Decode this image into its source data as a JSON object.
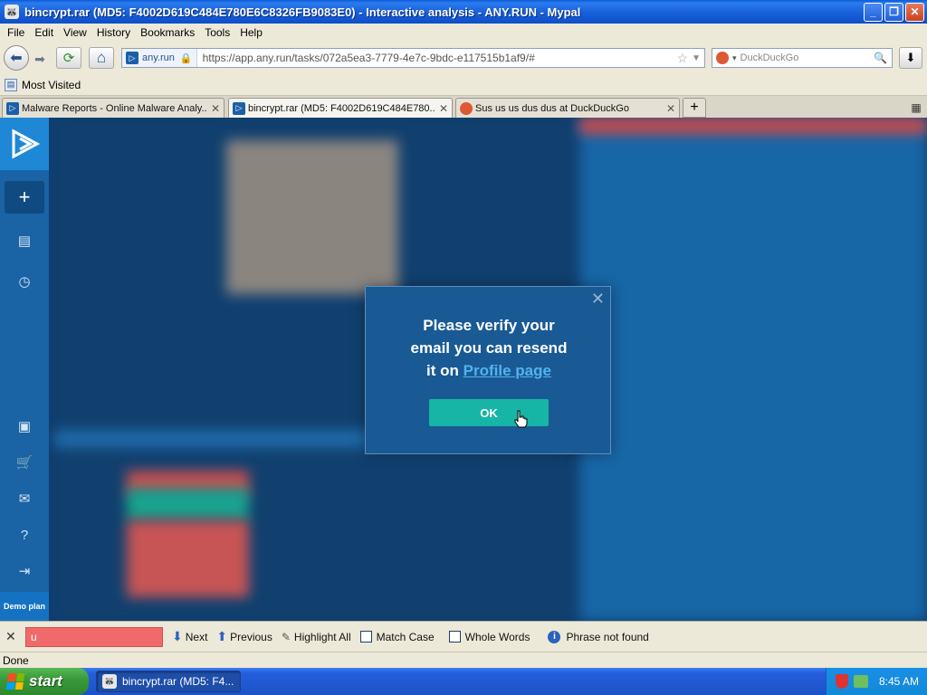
{
  "window": {
    "title": "bincrypt.rar (MD5: F4002D619C484E780E6C8326FB9083E0) - Interactive analysis - ANY.RUN - Mypal",
    "minimize": "_",
    "maximize": "❐",
    "close": "✕"
  },
  "menu": {
    "items": [
      "File",
      "Edit",
      "View",
      "History",
      "Bookmarks",
      "Tools",
      "Help"
    ]
  },
  "nav": {
    "back_glyph": "⬅",
    "forward_glyph": "➡",
    "reload_glyph": "⟳",
    "home_glyph": "⌂",
    "site_identity": "any.run",
    "url": "https://app.any.run/tasks/072a5ea3-7779-4e7c-9bdc-e117515b1af9/#",
    "search_engine": "DuckDuckGo",
    "search_placeholder": "DuckDuckGo",
    "download_glyph": "⬇"
  },
  "bookmarks": {
    "most_visited": "Most Visited"
  },
  "tabs": [
    {
      "label": "Malware Reports - Online Malware Analy...",
      "active": false
    },
    {
      "label": "bincrypt.rar (MD5: F4002D619C484E780...",
      "active": true
    },
    {
      "label": "Sus us us dus dus at DuckDuckGo",
      "active": false
    }
  ],
  "tab_close": "✕",
  "new_tab": "+",
  "tab_list": "▦",
  "sidebar": {
    "new_task": "+",
    "icons": [
      "document-icon",
      "history-icon",
      "account-icon",
      "cart-icon",
      "mail-icon",
      "help-icon",
      "logout-icon"
    ],
    "plan": "Demo plan"
  },
  "modal": {
    "message_line1": "Please verify your",
    "message_line2": "email you can resend",
    "message_line3_prefix": "it on",
    "link_text": "Profile page",
    "ok_label": "OK",
    "close_glyph": "✕"
  },
  "findbar": {
    "close_glyph": "✕",
    "query": "u",
    "next_label": "Next",
    "previous_label": "Previous",
    "highlight_all_label": "Highlight All",
    "match_case_label": "Match Case",
    "whole_words_label": "Whole Words",
    "status": "Phrase not found"
  },
  "statusbar": {
    "text": "Done"
  },
  "taskbar": {
    "start_label": "start",
    "task_label": "bincrypt.rar (MD5: F4...",
    "clock": "8:45 AM"
  },
  "colors": {
    "modal_bg": "#195a94",
    "ok_button": "#17b5a5",
    "link": "#53b2ee",
    "find_error": "#f16a6a",
    "sidebar": "#1a63a4"
  }
}
